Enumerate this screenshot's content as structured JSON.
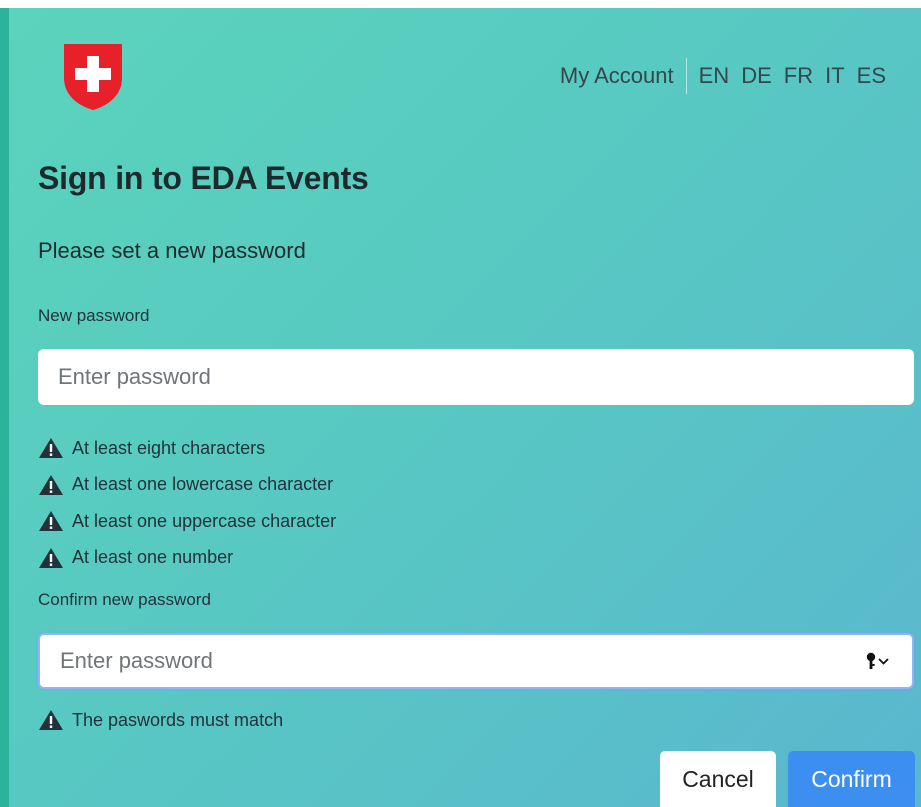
{
  "header": {
    "logo_icon": "swiss-cross-shield-icon",
    "account_link": "My Account",
    "languages": [
      "EN",
      "DE",
      "FR",
      "IT",
      "ES"
    ]
  },
  "main": {
    "title": "Sign in to EDA Events",
    "subtitle": "Please set a new password",
    "new_password": {
      "label": "New password",
      "placeholder": "Enter password",
      "value": "",
      "requirements": [
        "At least eight characters",
        "At least one lowercase character",
        "At least one uppercase character",
        "At least one number"
      ]
    },
    "confirm_password": {
      "label": "Confirm new password",
      "placeholder": "Enter password",
      "value": "",
      "toggle_icon": "key-dropdown-icon",
      "errors": [
        "The paswords must match"
      ]
    },
    "buttons": {
      "cancel": "Cancel",
      "confirm": "Confirm"
    }
  },
  "colors": {
    "accent": "#3d8ef1",
    "logo_red": "#e8202a",
    "warning_icon": "#22323a"
  }
}
